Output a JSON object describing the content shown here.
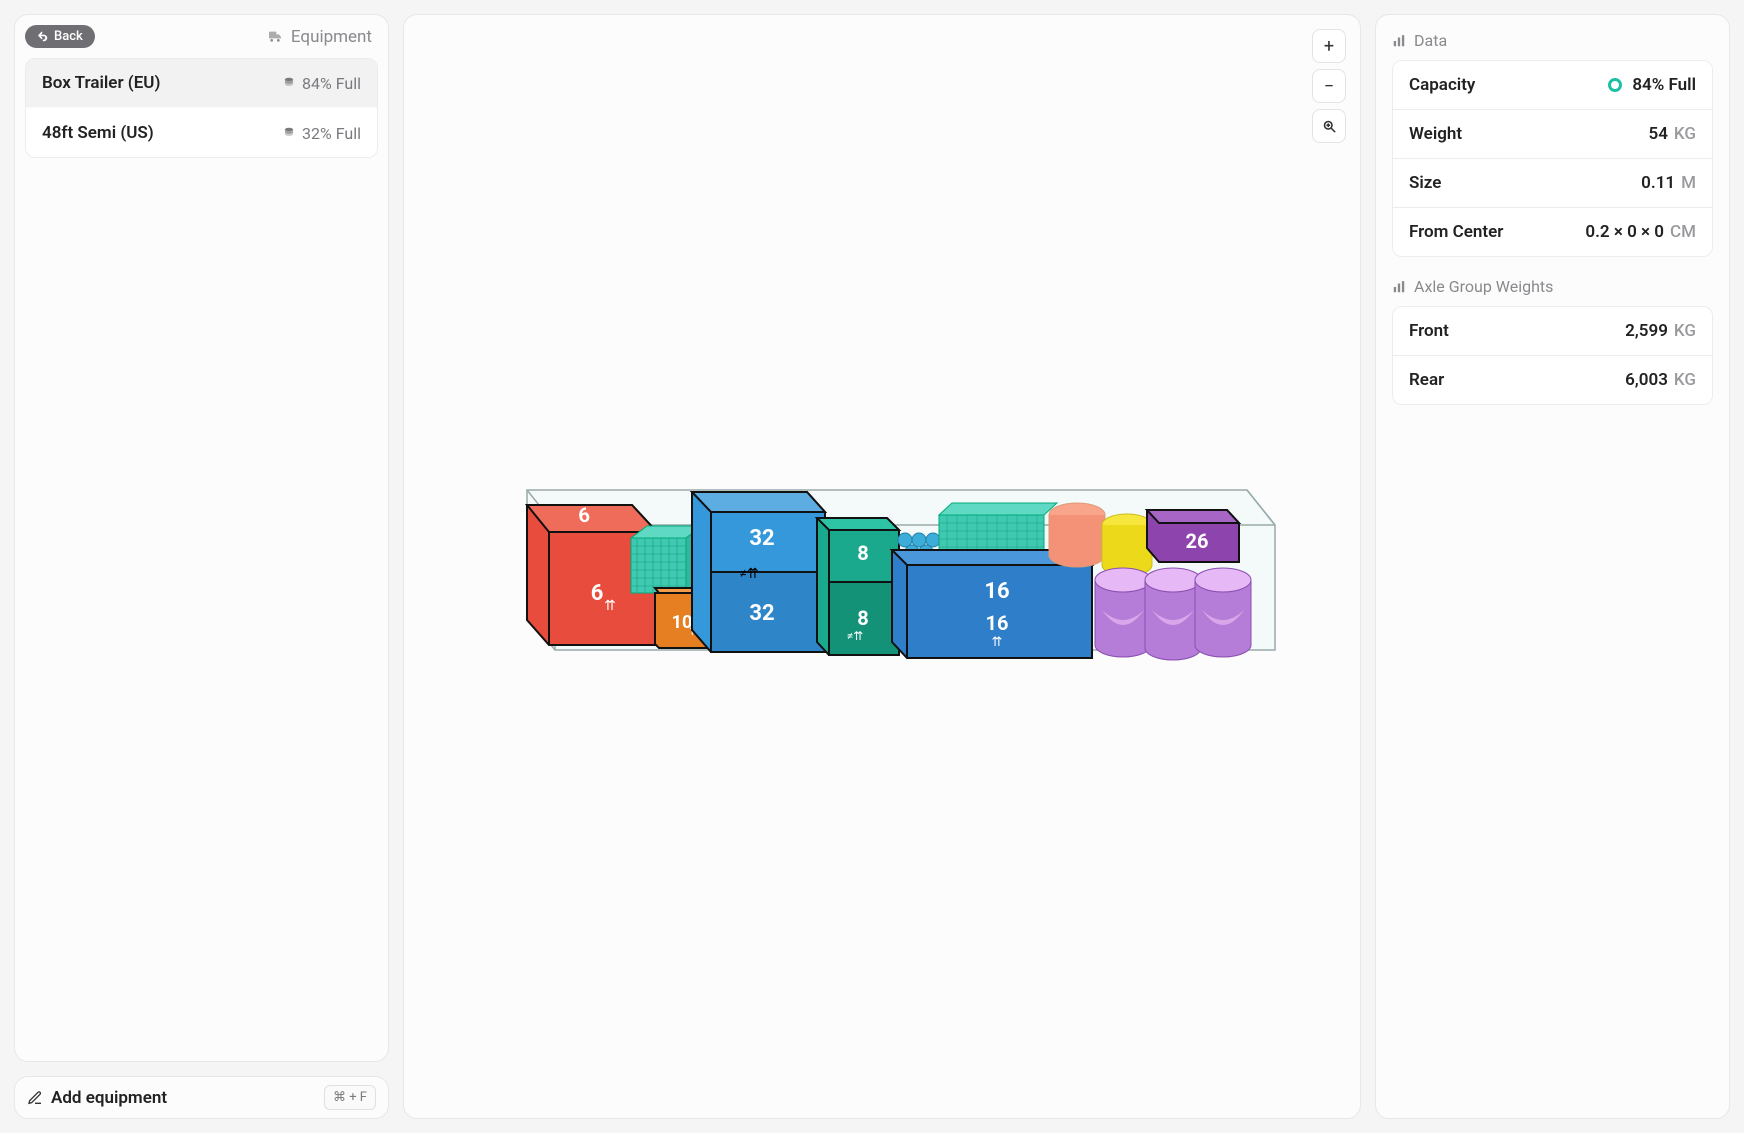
{
  "sidebar": {
    "back_label": "Back",
    "header_label": "Equipment",
    "items": [
      {
        "name": "Box Trailer (EU)",
        "fill": "84% Full",
        "selected": true
      },
      {
        "name": "48ft Semi (US)",
        "fill": "32% Full",
        "selected": false
      }
    ],
    "add_label": "Add equipment",
    "add_kbd": "⌘ + F"
  },
  "data_panel": {
    "title": "Data",
    "capacity": {
      "label": "Capacity",
      "value": "84% Full"
    },
    "weight": {
      "label": "Weight",
      "value": "54",
      "unit": "KG"
    },
    "size": {
      "label": "Size",
      "value": "0.11",
      "unit": "M"
    },
    "from_center": {
      "label": "From Center",
      "value": "0.2 × 0 × 0",
      "unit": "CM"
    }
  },
  "axle_panel": {
    "title": "Axle Group Weights",
    "front": {
      "label": "Front",
      "value": "2,599",
      "unit": "KG"
    },
    "rear": {
      "label": "Rear",
      "value": "6,003",
      "unit": "KG"
    }
  },
  "boxes": {
    "b6": "6",
    "b6f": "6",
    "b10": "10",
    "b32": "32",
    "b32f": "32",
    "b8": "8",
    "b8f": "8",
    "b16": "16",
    "b16f": "16",
    "b26": "26"
  }
}
